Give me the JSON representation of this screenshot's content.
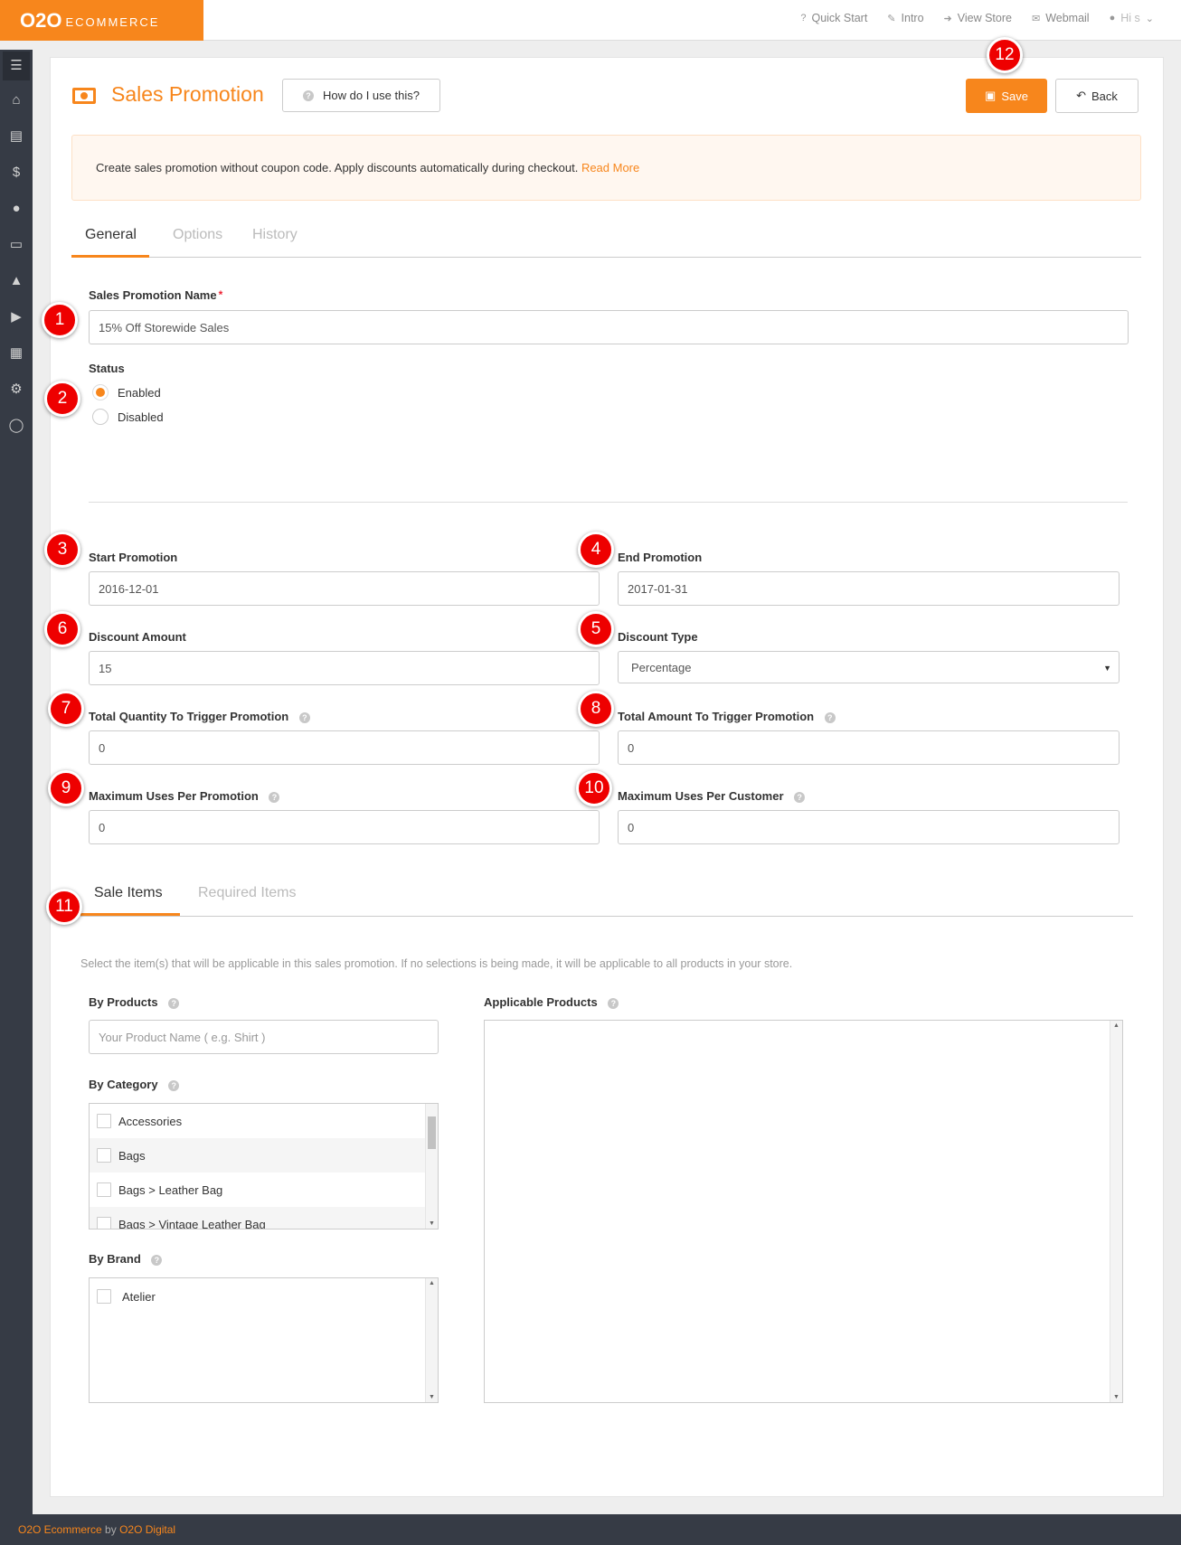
{
  "brand": {
    "logo_main": "O2O",
    "logo_sub": "ECOMMERCE"
  },
  "topnav": [
    {
      "icon": "?",
      "label": "Quick Start"
    },
    {
      "icon": "✎",
      "label": "Intro"
    },
    {
      "icon": "➜",
      "label": "View Store"
    },
    {
      "icon": "✉",
      "label": "Webmail"
    }
  ],
  "user": {
    "label": "Hi s"
  },
  "sidebar_icons": [
    "menu-icon",
    "home-icon",
    "cart-icon",
    "dollar-icon",
    "user-icon",
    "book-icon",
    "thumbs-up-icon",
    "megaphone-icon",
    "chart-icon",
    "gears-icon",
    "chat-icon"
  ],
  "header": {
    "title": "Sales Promotion",
    "howto_label": "How do I use this?",
    "save_label": "Save",
    "back_label": "Back"
  },
  "notice": {
    "text": "Create sales promotion without coupon code. Apply discounts automatically during checkout.",
    "link": "Read More"
  },
  "tabs": [
    {
      "label": "General",
      "active": true
    },
    {
      "label": "Options",
      "active": false
    },
    {
      "label": "History",
      "active": false
    }
  ],
  "form": {
    "name_label": "Sales Promotion Name",
    "name_required": "*",
    "name_value": "15% Off Storewide Sales",
    "status_label": "Status",
    "status_options": [
      "Enabled",
      "Disabled"
    ],
    "status_selected": "Enabled",
    "start_label": "Start Promotion",
    "start_value": "2016-12-01",
    "end_label": "End Promotion",
    "end_value": "2017-01-31",
    "discount_amount_label": "Discount Amount",
    "discount_amount_value": "15",
    "discount_type_label": "Discount Type",
    "discount_type_value": "Percentage",
    "total_qty_label": "Total Quantity To Trigger Promotion",
    "total_qty_value": "0",
    "total_amount_label": "Total Amount To Trigger Promotion",
    "total_amount_value": "0",
    "max_uses_promo_label": "Maximum Uses Per Promotion",
    "max_uses_promo_value": "0",
    "max_uses_customer_label": "Maximum Uses Per Customer",
    "max_uses_customer_value": "0"
  },
  "sale_tabs": [
    {
      "label": "Sale Items",
      "active": true
    },
    {
      "label": "Required Items",
      "active": false
    }
  ],
  "sale_items": {
    "help_text": "Select the item(s) that will be applicable in this sales promotion. If no selections is being made, it will be applicable to all products in your store.",
    "by_products_label": "By Products",
    "product_placeholder": "Your Product Name ( e.g. Shirt )",
    "applicable_products_label": "Applicable Products",
    "by_category_label": "By Category",
    "categories": [
      "Accessories",
      "Bags",
      "Bags > Leather Bag",
      "Bags > Vintage Leather Bag"
    ],
    "by_brand_label": "By Brand",
    "brands": [
      "Atelier"
    ]
  },
  "badges": [
    "1",
    "2",
    "3",
    "4",
    "5",
    "6",
    "7",
    "8",
    "9",
    "10",
    "11",
    "12"
  ],
  "footer": {
    "part1": "O2O Ecommerce",
    "part2": "by",
    "part3": "O2O Digital"
  }
}
